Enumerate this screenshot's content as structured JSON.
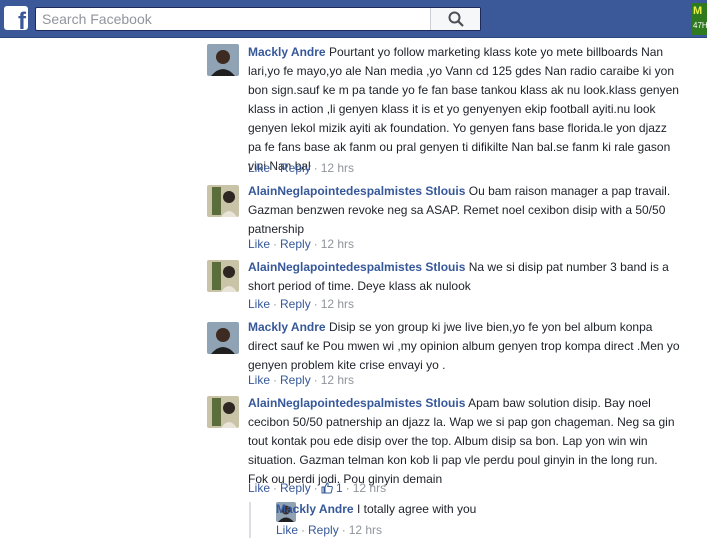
{
  "topbar": {
    "logo_letter": "f",
    "search_placeholder": "Search Facebook",
    "corner_chip_top": "M",
    "corner_chip_bottom": "47H"
  },
  "comments": [
    {
      "author": "Mackly Andre",
      "text": "Pourtant yo follow marketing klass kote yo mete billboards Nan lari,yo fe mayo,yo ale Nan media ,yo Vann cd 125 gdes Nan radio caraibe ki yon bon sign.sauf ke m pa tande yo fe fan base tankou klass ak nu look.klass genyen klass in action ,li genyen klass it is et yo genyenyen ekip football ayiti.nu look genyen lekol mizik ayiti ak foundation. Yo genyen fans base florida.le yon djazz pa fe fans base ak fanm ou pral genyen ti difikilte Nan bal.se fanm ki rale gason vini Nan bal",
      "like": "Like",
      "reply": "Reply",
      "time": "12 hrs"
    },
    {
      "author": "AlainNeglapointedespalmistes Stlouis",
      "text": "Ou bam raison manager a pap travail. Gazman benzwen revoke neg sa ASAP. Remet noel cexibon disip with a 50/50 patnership",
      "like": "Like",
      "reply": "Reply",
      "time": "12 hrs"
    },
    {
      "author": "AlainNeglapointedespalmistes Stlouis",
      "text": "Na we si disip pat number 3 band is a short period of time. Deye klass ak nulook",
      "like": "Like",
      "reply": "Reply",
      "time": "12 hrs"
    },
    {
      "author": "Mackly Andre",
      "text": "Disip se yon group ki jwe live bien,yo fe yon bel album konpa direct sauf ke Pou mwen wi ,my opinion album genyen trop kompa direct .Men yo genyen problem kite crise envayi yo .",
      "like": "Like",
      "reply": "Reply",
      "time": "12 hrs"
    },
    {
      "author": "AlainNeglapointedespalmistes Stlouis",
      "text": "Apam baw solution disip. Bay noel cecibon 50/50 patnership an djazz la. Wap we si pap gon chageman. Neg sa gin tout kontak pou ede disip over the top. Album disip sa bon. Lap yon win win situation. Gazman telman kon kob li pap vle perdu poul ginyin in the long run. Fok ou perdi jodi. Pou ginyin demain",
      "like": "Like",
      "reply": "Reply",
      "reactions": "1",
      "time": "12 hrs"
    }
  ],
  "reply": {
    "author": "Mackly Andre",
    "text": "I totally agree with you",
    "like": "Like",
    "reply": "Reply",
    "time": "12 hrs"
  },
  "colors": {
    "topbar": "#3b5998",
    "author_link": "#365899",
    "meta_gray": "#90949c"
  }
}
